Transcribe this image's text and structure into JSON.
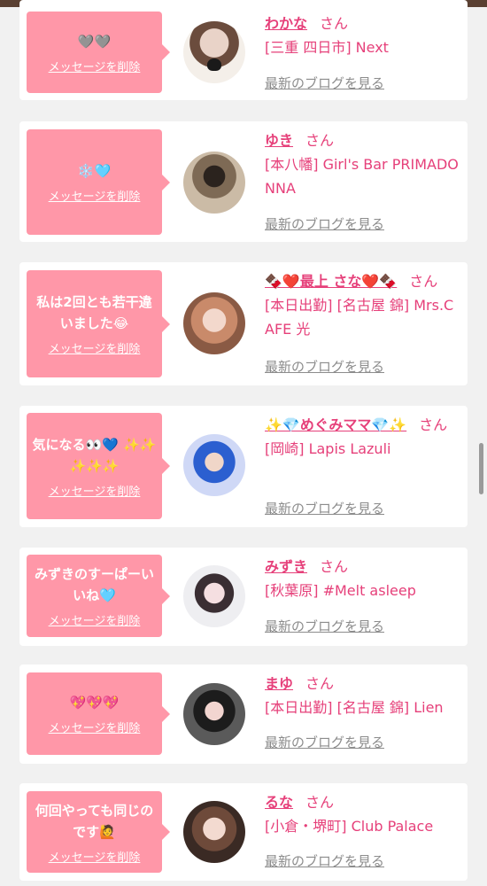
{
  "delete_label": "メッセージを削除",
  "blog_label": "最新のブログを見る",
  "san": "さん",
  "entries": [
    {
      "message": "🩶🩶",
      "name": "わかな",
      "shop": "[三重 四日市] Next"
    },
    {
      "message": "❄️🩵",
      "name": "ゆき",
      "shop": "[本八幡] Girl's Bar PRIMADONNA"
    },
    {
      "message": "私は2回とも若干違いました😂",
      "name": "🍫❤️最上 さな❤️🍫",
      "shop": "[本日出勤] [名古屋 錦] Mrs.CAFE 光"
    },
    {
      "message": "気になる👀💙 ✨✨✨✨✨",
      "name": "✨💎めぐみママ💎✨",
      "shop": "[岡崎] Lapis Lazuli"
    },
    {
      "message": "みずきのすーぱーいいね🩵",
      "name": "みずき",
      "shop": "[秋葉原] #Melt asleep"
    },
    {
      "message": "💖💖💖",
      "name": "まゆ",
      "shop": "[本日出勤] [名古屋 錦] Lien"
    },
    {
      "message": "何回やっても同じのです🙋",
      "name": "るな",
      "shop": "[小倉・堺町] Club Palace"
    }
  ]
}
